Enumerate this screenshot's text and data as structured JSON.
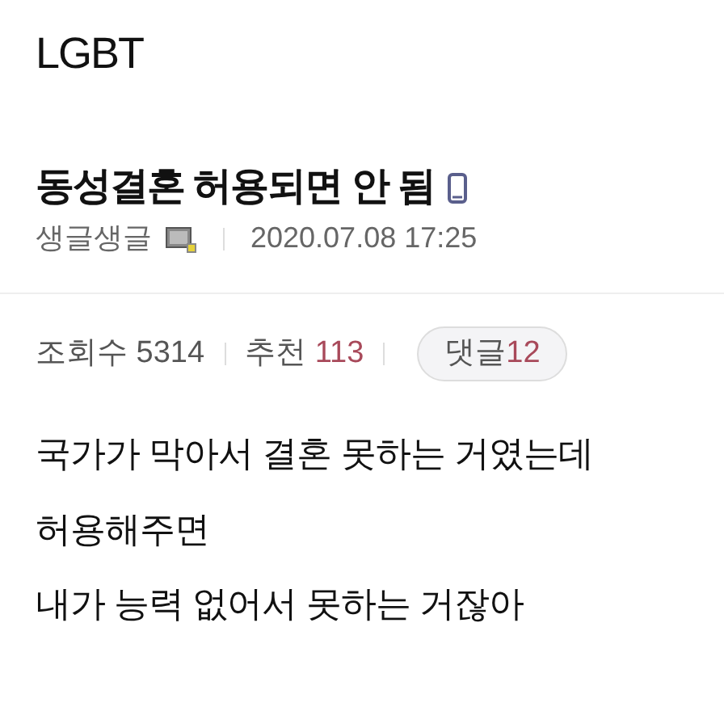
{
  "board": {
    "title": "LGBT"
  },
  "post": {
    "title": "동성결혼 허용되면 안 됨",
    "author": "생글생글",
    "date": "2020.07.08 17:25",
    "views_label": "조회수",
    "views": "5314",
    "likes_label": "추천",
    "likes": "113",
    "comments_label": "댓글",
    "comments": "12",
    "body": [
      "국가가 막아서 결혼 못하는 거였는데",
      "허용해주면",
      "내가 능력 없어서 못하는 거잖아"
    ]
  }
}
